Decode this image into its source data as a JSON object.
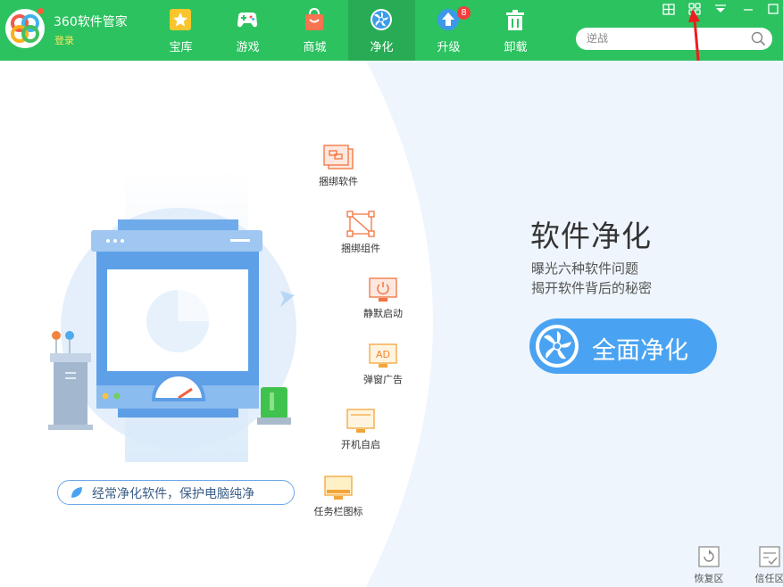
{
  "app": {
    "title": "360软件管家",
    "login_label": "登录"
  },
  "nav": [
    {
      "label": "宝库",
      "icon": "star-icon"
    },
    {
      "label": "游戏",
      "icon": "gamepad-icon"
    },
    {
      "label": "商城",
      "icon": "shopping-bag-icon"
    },
    {
      "label": "净化",
      "icon": "fan-icon",
      "active": true
    },
    {
      "label": "升级",
      "icon": "upload-arrow-icon",
      "badge": "8"
    },
    {
      "label": "卸载",
      "icon": "trash-icon"
    }
  ],
  "search": {
    "placeholder": "逆战"
  },
  "features": [
    {
      "label": "捆绑软件",
      "icon": "bundled-software-icon"
    },
    {
      "label": "捆绑组件",
      "icon": "bundled-component-icon"
    },
    {
      "label": "静默启动",
      "icon": "silent-start-icon"
    },
    {
      "label": "弹窗广告",
      "icon": "popup-ad-icon",
      "icon_text": "AD"
    },
    {
      "label": "开机自启",
      "icon": "autostart-icon"
    },
    {
      "label": "任务栏图标",
      "icon": "taskbar-icon"
    }
  ],
  "hero": {
    "title": "软件净化",
    "line1": "曝光六种软件问题",
    "line2": "揭开软件背后的秘密",
    "button_label": "全面净化"
  },
  "slogan": "经常净化软件，保护电脑纯净",
  "bottom": [
    {
      "label": "恢复区",
      "icon": "restore-icon"
    },
    {
      "label": "信任区",
      "icon": "trust-icon"
    }
  ],
  "colors": {
    "brand_green": "#2cc260",
    "active_tab": "#27ac55",
    "accent_blue": "#4aa3f2",
    "login_yellow": "#fde55d",
    "annotation_red": "#ee1c1c"
  }
}
